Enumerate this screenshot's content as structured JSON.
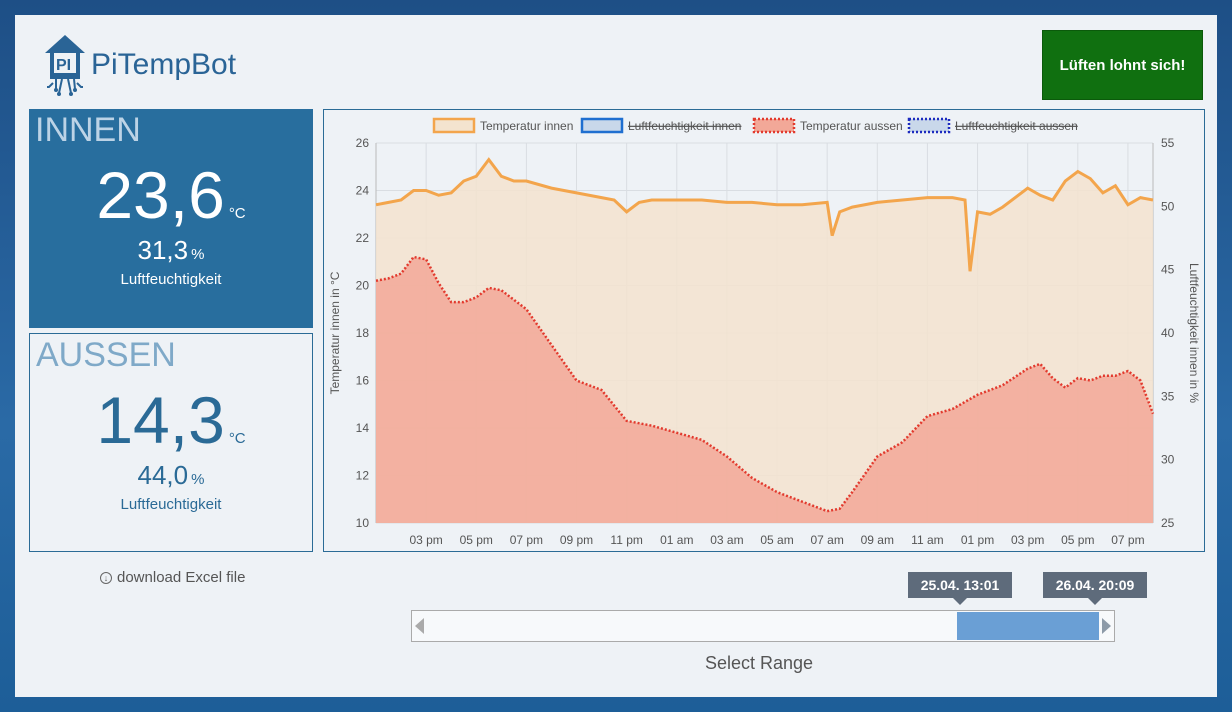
{
  "app": {
    "title": "PiTempBot",
    "logo_letters": "PI"
  },
  "status_button": {
    "label": "Lüften lohnt sich!",
    "color": "#107010"
  },
  "inside": {
    "title": "INNEN",
    "temperature": "23,6",
    "temperature_unit": "°C",
    "humidity": "31,3",
    "humidity_unit": "%",
    "humidity_label": "Luftfeuchtigkeit"
  },
  "outside": {
    "title": "AUSSEN",
    "temperature": "14,3",
    "temperature_unit": "°C",
    "humidity": "44,0",
    "humidity_unit": "%",
    "humidity_label": "Luftfeuchtigkeit"
  },
  "download": {
    "label": "download Excel file",
    "icon": "download-circle-icon"
  },
  "range_slider": {
    "start_label": "25.04. 13:01",
    "end_label": "26.04. 20:09",
    "caption": "Select Range",
    "selected_from_fraction": 0.78,
    "selected_to_fraction": 0.98
  },
  "chart_data": {
    "type": "area",
    "legend_position": "top",
    "grid": true,
    "x_ticks": [
      "03 pm",
      "05 pm",
      "07 pm",
      "09 pm",
      "11 pm",
      "01 am",
      "03 am",
      "05 am",
      "07 am",
      "09 am",
      "11 am",
      "01 pm",
      "03 pm",
      "05 pm",
      "07 pm"
    ],
    "x_hours": [
      0,
      2,
      4,
      6,
      8,
      10,
      12,
      14,
      16,
      18,
      20,
      22,
      24,
      26,
      28
    ],
    "x_range": [
      -2,
      29
    ],
    "ylabel_left": "Temperatur innen in °C",
    "ylabel_right": "Luftfeuchtigkeit innen in %",
    "ylim_left": [
      10,
      26
    ],
    "ylim_right": [
      25,
      55
    ],
    "y_ticks_left": [
      10,
      12,
      14,
      16,
      18,
      20,
      22,
      24,
      26
    ],
    "y_ticks_right": [
      25,
      30,
      35,
      40,
      45,
      50,
      55
    ],
    "series": [
      {
        "name": "Temperatur innen",
        "hidden": false,
        "color": "#f3a54c",
        "fill": "#f3e3cf",
        "x": [
          -2,
          -1.5,
          -1,
          -0.5,
          0,
          0.5,
          1,
          1.5,
          2,
          2.5,
          3,
          3.5,
          4,
          5,
          6,
          7,
          7.5,
          8,
          8.5,
          9,
          10,
          11,
          12,
          13,
          14,
          15,
          16,
          16.2,
          16.5,
          17,
          18,
          19,
          20,
          21,
          21.5,
          21.7,
          22,
          22.5,
          23,
          24,
          24.5,
          25,
          25.5,
          26,
          26.5,
          27,
          27.5,
          28,
          28.5,
          29
        ],
        "y": [
          23.4,
          23.5,
          23.6,
          24.0,
          24.0,
          23.8,
          23.9,
          24.4,
          24.6,
          25.3,
          24.6,
          24.4,
          24.4,
          24.1,
          23.9,
          23.7,
          23.6,
          23.1,
          23.5,
          23.6,
          23.6,
          23.6,
          23.5,
          23.5,
          23.4,
          23.4,
          23.5,
          22.1,
          23.1,
          23.3,
          23.5,
          23.6,
          23.7,
          23.7,
          23.6,
          20.6,
          23.1,
          23.0,
          23.3,
          24.1,
          23.8,
          23.6,
          24.4,
          24.8,
          24.5,
          23.9,
          24.2,
          23.4,
          23.7,
          23.6
        ]
      },
      {
        "name": "Luftfeuchtigkeit innen",
        "hidden": true,
        "color": "#1f6fd0",
        "fill": "#c9d8ea"
      },
      {
        "name": "Temperatur aussen",
        "hidden": false,
        "color": "#e23a2e",
        "fill": "#f2a898",
        "x": [
          -2,
          -1.5,
          -1,
          -0.5,
          0,
          0.5,
          1,
          1.5,
          2,
          2.5,
          3,
          3.5,
          4,
          5,
          6,
          7,
          8,
          9,
          10,
          11,
          12,
          13,
          14,
          15,
          16,
          16.5,
          17,
          18,
          19,
          20,
          21,
          22,
          23,
          24,
          24.5,
          25,
          25.5,
          26,
          26.5,
          27,
          27.5,
          28,
          28.5,
          29
        ],
        "y": [
          20.2,
          20.3,
          20.5,
          21.2,
          21.1,
          20.1,
          19.3,
          19.3,
          19.5,
          19.9,
          19.8,
          19.4,
          19.0,
          17.5,
          16.0,
          15.6,
          14.3,
          14.1,
          13.8,
          13.5,
          12.8,
          11.9,
          11.3,
          10.9,
          10.5,
          10.6,
          11.3,
          12.8,
          13.4,
          14.5,
          14.8,
          15.4,
          15.8,
          16.5,
          16.7,
          16.1,
          15.7,
          16.1,
          16.0,
          16.2,
          16.2,
          16.4,
          16.0,
          14.6
        ]
      },
      {
        "name": "Luftfeuchtigkeit aussen",
        "hidden": true,
        "color": "#1c2bbf",
        "fill": "#c9d8ea"
      }
    ]
  }
}
